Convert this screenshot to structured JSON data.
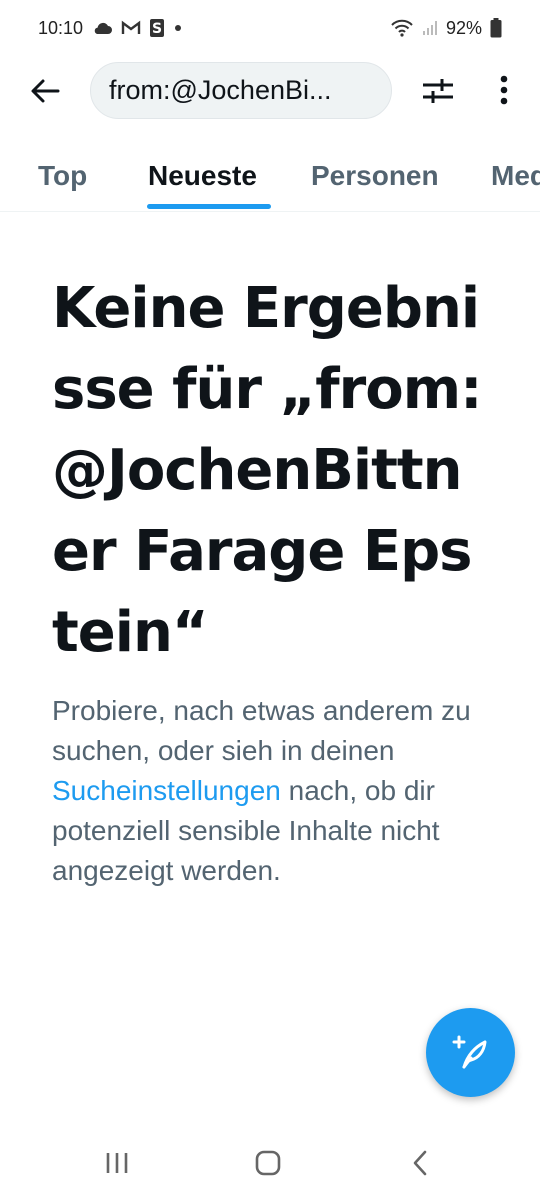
{
  "status_bar": {
    "time": "10:10",
    "left_icons": [
      "cloud-icon",
      "gmail-icon",
      "s-app-icon",
      "dot-icon"
    ],
    "battery_percent": "92%",
    "right_icons": [
      "wifi-icon",
      "signal-icon",
      "battery-icon"
    ]
  },
  "header": {
    "search_query": "from:@JochenBi...",
    "back_icon": "arrow-left-icon",
    "filter_icon": "sliders-icon",
    "more_icon": "more-vertical-icon"
  },
  "tabs": [
    {
      "label": "Top",
      "active": false
    },
    {
      "label": "Neueste",
      "active": true
    },
    {
      "label": "Personen",
      "active": false
    },
    {
      "label": "Medien",
      "active": false
    }
  ],
  "empty_state": {
    "title": "Keine Ergebnisse für „from:@JochenBittner Farage Epstein“",
    "text_before": "Probiere, nach etwas anderem zu suchen, oder sieh in deinen ",
    "link": "Sucheinstellungen",
    "text_after": " nach, ob dir potenziell sensible Inhalte nicht angezeigt werden."
  },
  "fab": {
    "icon": "compose-feather-icon"
  },
  "nav_bar": {
    "icons": [
      "recent-apps-icon",
      "home-icon",
      "back-icon"
    ]
  },
  "colors": {
    "accent": "#1d9bf0",
    "text_primary": "#0f1419",
    "text_secondary": "#536471"
  }
}
